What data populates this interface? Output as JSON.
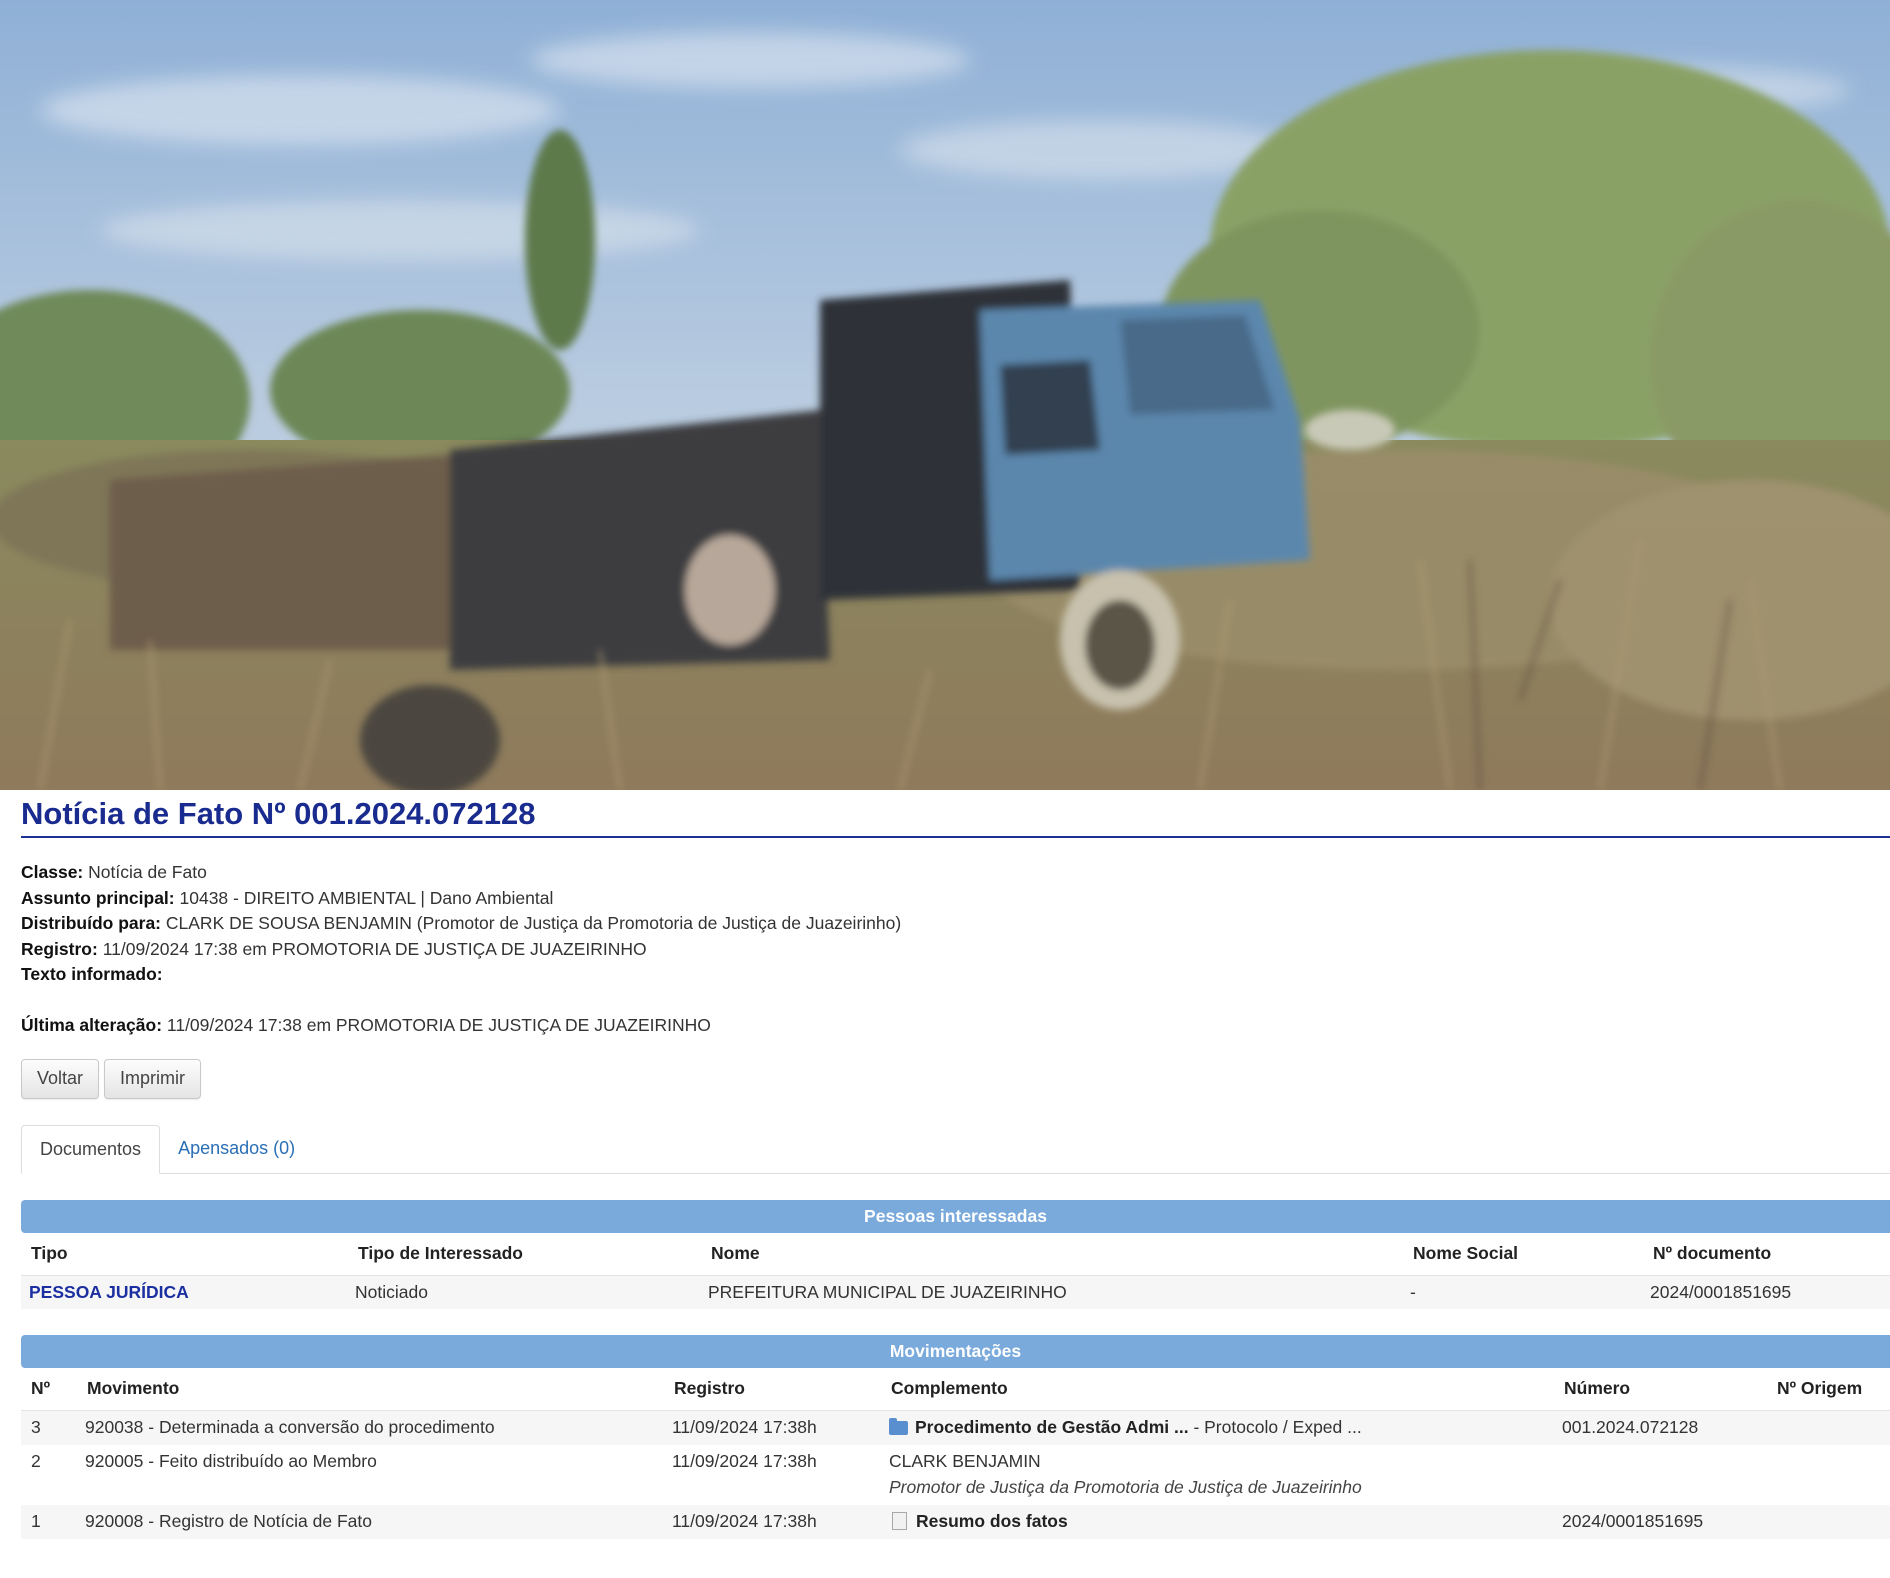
{
  "notice": {
    "title": "Notícia de Fato Nº 001.2024.072128",
    "fields": {
      "classe_label": "Classe:",
      "classe_value": "Notícia de Fato",
      "assunto_label": "Assunto principal:",
      "assunto_value": "10438 - DIREITO AMBIENTAL | Dano Ambiental",
      "distribuido_label": "Distribuído para:",
      "distribuido_value": "CLARK DE SOUSA BENJAMIN (Promotor de Justiça da Promotoria de Justiça de Juazeirinho)",
      "registro_label": "Registro:",
      "registro_value": "11/09/2024 17:38 em PROMOTORIA DE JUSTIÇA DE JUAZEIRINHO",
      "texto_label": "Texto informado:",
      "ultima_label": "Última alteração:",
      "ultima_value": "11/09/2024 17:38 em PROMOTORIA DE JUSTIÇA DE JUAZEIRINHO"
    }
  },
  "buttons": {
    "voltar": "Voltar",
    "imprimir": "Imprimir"
  },
  "tabs": {
    "documentos": "Documentos",
    "apensados": "Apensados (0)"
  },
  "pessoas": {
    "heading": "Pessoas interessadas",
    "columns": {
      "tipo": "Tipo",
      "tipo_interessado": "Tipo de Interessado",
      "nome": "Nome",
      "nome_social": "Nome Social",
      "documento": "Nº documento"
    },
    "rows": [
      {
        "tipo": "PESSOA JURÍDICA",
        "tipo_interessado": "Noticiado",
        "nome": "PREFEITURA MUNICIPAL DE JUAZEIRINHO",
        "nome_social": "-",
        "documento": "2024/0001851695"
      }
    ]
  },
  "movimentacoes": {
    "heading": "Movimentações",
    "columns": {
      "n": "Nº",
      "movimento": "Movimento",
      "registro": "Registro",
      "complemento": "Complemento",
      "numero": "Número",
      "origem": "Nº Origem"
    },
    "rows": [
      {
        "n": "3",
        "movimento": "920038 - Determinada a conversão do procedimento",
        "registro": "11/09/2024 17:38h",
        "complemento_bold": "Procedimento de Gestão Admi ...",
        "complemento_rest": " - Protocolo / Exped ...",
        "numero": "001.2024.072128",
        "origem": ""
      },
      {
        "n": "2",
        "movimento": "920005 - Feito distribuído ao Membro",
        "registro": "11/09/2024 17:38h",
        "complemento_line1": "CLARK BENJAMIN",
        "complemento_line2": "Promotor de Justiça da Promotoria de Justiça de Juazeirinho",
        "numero": "",
        "origem": ""
      },
      {
        "n": "1",
        "movimento": "920008 - Registro de Notícia de Fato",
        "registro": "11/09/2024 17:38h",
        "complemento_bold": "Resumo dos fatos",
        "numero": "2024/0001851695",
        "origem": ""
      }
    ]
  },
  "icons": {
    "folder": "folder-icon",
    "document": "document-icon"
  },
  "colors": {
    "title": "#1a2b8f",
    "section_bar": "#7aaadb",
    "link": "#2a6fb5",
    "pessoa_juridica": "#1b2fa0"
  }
}
